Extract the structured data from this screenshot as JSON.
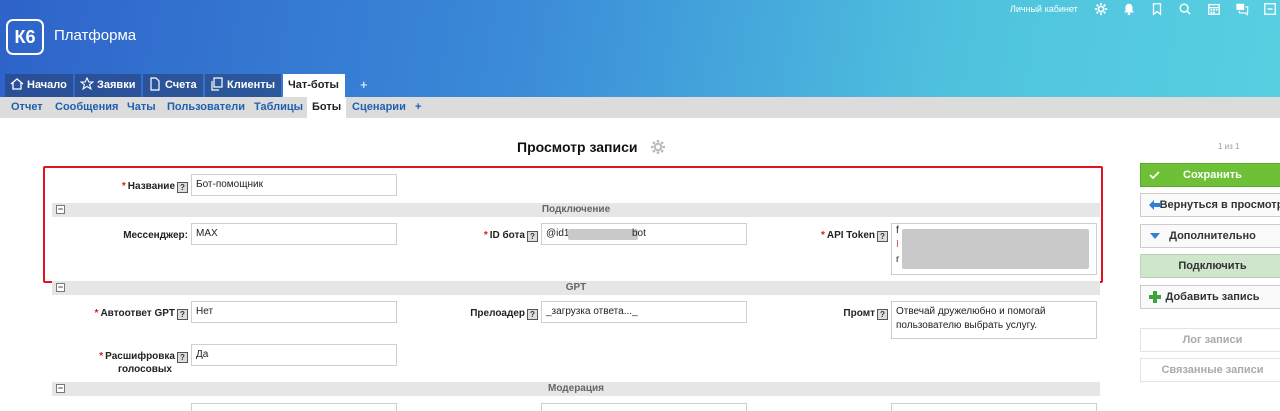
{
  "header": {
    "logo": "К6",
    "app_title": "Платформа",
    "cabinet": "Личный кабинет",
    "icons": [
      "gear-icon",
      "bell-icon",
      "bookmark-icon",
      "search-icon",
      "calendar-icon",
      "chat-icon",
      "minus-square-icon"
    ]
  },
  "tabs": [
    {
      "label": "Начало",
      "icon": "home-icon"
    },
    {
      "label": "Заявки",
      "icon": "star-icon"
    },
    {
      "label": "Счета",
      "icon": "document-icon"
    },
    {
      "label": "Клиенты",
      "icon": "copy-icon"
    },
    {
      "label": "Чат-боты",
      "active": true
    }
  ],
  "tab_plus": "+",
  "subnav": [
    {
      "label": "Отчет"
    },
    {
      "label": "Сообщения"
    },
    {
      "label": "Чаты"
    },
    {
      "label": "Пользователи"
    },
    {
      "label": "Таблицы"
    },
    {
      "label": "Боты",
      "active": true
    },
    {
      "label": "Сценарии"
    }
  ],
  "subnav_plus": "+",
  "page": {
    "title": "Просмотр записи"
  },
  "form": {
    "name_label": "Название",
    "name_value": "Бот-помощник",
    "section_connection": "Подключение",
    "messenger_label": "Мессенджер:",
    "messenger_value": "MAX",
    "bot_id_label": "ID бота",
    "bot_id_prefix": "@id1",
    "bot_id_suffix": "bot",
    "api_token_label": "API Token",
    "api_token_visible_chars": [
      "f",
      "I",
      "r"
    ],
    "section_gpt": "GPT",
    "autoreply_label": "Автоответ GPT",
    "autoreply_value": "Нет",
    "preloader_label": "Прелоадер",
    "preloader_value": "_загрузка ответа..._",
    "prompt_label": "Промт",
    "prompt_value": "Отвечай дружелюбно и помогай пользователю выбрать услугу.",
    "voice_label_1": "Расшифровка",
    "voice_label_2": "голосовых",
    "voice_value": "Да",
    "section_moderation": "Модерация",
    "help_mark": "?",
    "collapse_mark": "−",
    "required_mark": "*"
  },
  "side": {
    "counter": "1 из 1",
    "save": "Сохранить",
    "back": "Вернуться в просмотр",
    "more": "Дополнительно",
    "connect": "Подключить",
    "add": "Добавить запись",
    "log": "Лог записи",
    "related": "Связанные записи"
  },
  "colors": {
    "header_start": "#2e63c9",
    "header_end": "#58cfe1",
    "link": "#2060b0",
    "save_green": "#6ec137",
    "highlight_red": "#e0141e"
  }
}
